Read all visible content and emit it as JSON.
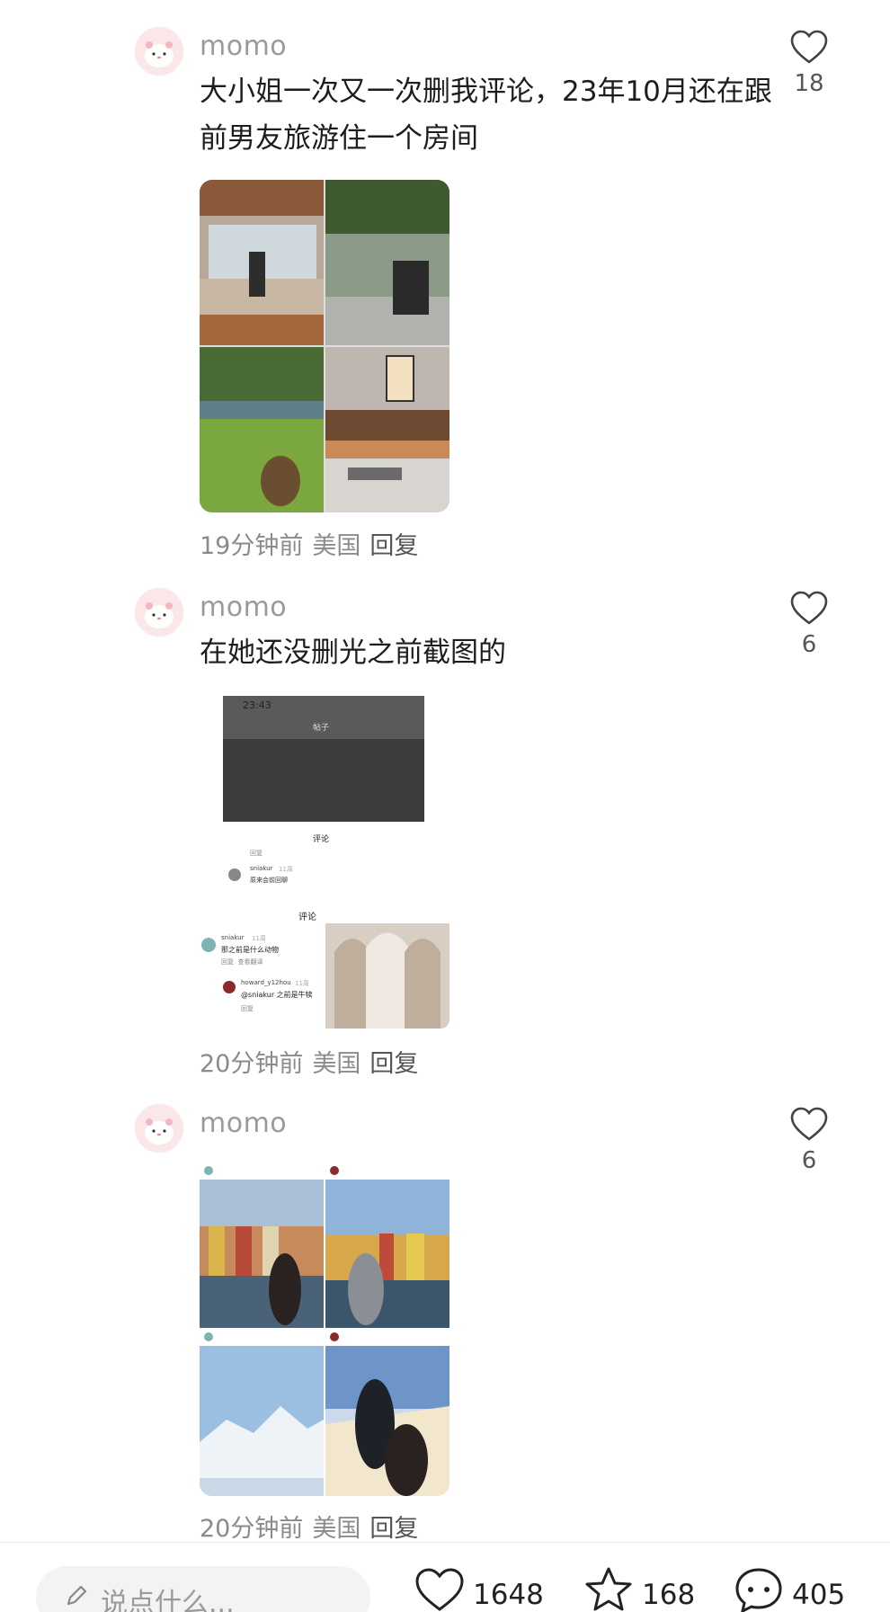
{
  "comments": [
    {
      "username": "momo",
      "text": "大小姐一次又一次删我评论，23年10月还在跟前男友旅游住一个房间",
      "likes": "18",
      "time": "19分钟前",
      "location": "美国",
      "reply": "回复"
    },
    {
      "username": "momo",
      "text": "在她还没删光之前截图的",
      "likes": "6",
      "time": "20分钟前",
      "location": "美国",
      "reply": "回复",
      "screenshot": {
        "status_time": "23:43",
        "header_title": "帖子",
        "sheet_title": "评论",
        "reply_hint": "回复",
        "user1": "sniakur",
        "user1_time": "11周",
        "user1_text": "原来会前回聊",
        "inner_title": "评论",
        "user2": "sniakur",
        "user2_time": "11周",
        "user2_text": "那之前是什么动物",
        "user2_actions": "回复  查看翻译",
        "user3": "howard_y12hou",
        "user3_time": "11周",
        "user3_text": "@sniakur 之前是牛犊",
        "user3_reply": "回复"
      }
    },
    {
      "username": "momo",
      "text": "",
      "likes": "6",
      "time": "20分钟前",
      "location": "美国",
      "reply": "回复"
    }
  ],
  "bottom_bar": {
    "placeholder": "说点什么...",
    "likes": "1648",
    "favorites": "168",
    "comments": "405"
  },
  "colors": {
    "accent_text": "#1d1d1d",
    "muted": "#9a9a9a",
    "avatar_bg": "#fbe6e8"
  },
  "icons": [
    "pencil-icon",
    "heart-icon",
    "star-icon",
    "chat-bubble-icon"
  ]
}
